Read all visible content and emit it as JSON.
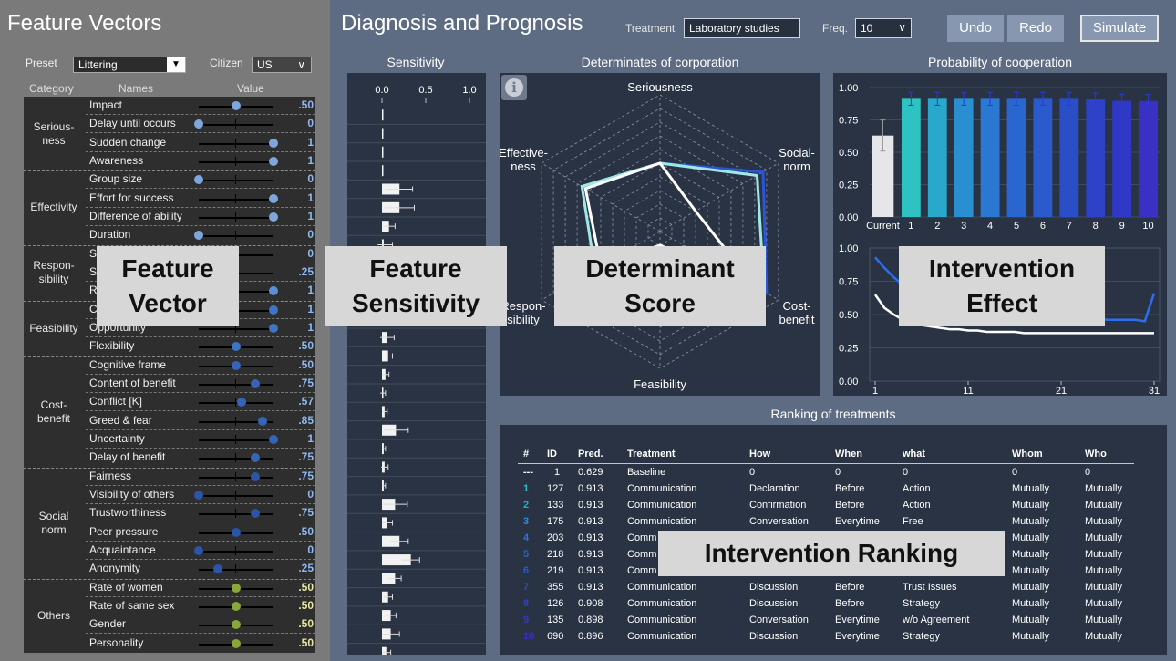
{
  "left": {
    "title": "Feature Vectors",
    "preset_label": "Preset",
    "preset_value": "Littering",
    "citizen_label": "Citizen",
    "citizen_value": "US",
    "headers": [
      "Category",
      "Names",
      "Value"
    ],
    "groups": [
      {
        "name": "Serious-\nness",
        "knob_color": "#7fa6dc",
        "val_color": "#8fb8f0",
        "features": [
          {
            "name": "Impact",
            "value": 0.5,
            "label": ".50"
          },
          {
            "name": "Delay until occurs",
            "value": 0,
            "label": "0"
          },
          {
            "name": "Sudden change",
            "value": 1,
            "label": "1"
          },
          {
            "name": "Awareness",
            "value": 1,
            "label": "1"
          }
        ]
      },
      {
        "name": "Effectivity",
        "knob_color": "#7fa6dc",
        "val_color": "#8fb8f0",
        "features": [
          {
            "name": "Group size",
            "value": 0,
            "label": "0"
          },
          {
            "name": "Effort for success",
            "value": 1,
            "label": "1"
          },
          {
            "name": "Difference of ability",
            "value": 1,
            "label": "1"
          },
          {
            "name": "Duration",
            "value": 0,
            "label": "0"
          }
        ]
      },
      {
        "name": "Respon-\nsibility",
        "knob_color": "#5b8fd6",
        "val_color": "#8fb8f0",
        "features": [
          {
            "name": "S",
            "value": 0,
            "label": "0"
          },
          {
            "name": "S",
            "value": 0.25,
            "label": ".25"
          },
          {
            "name": "R",
            "value": 1,
            "label": "1"
          }
        ]
      },
      {
        "name": "Feasibility",
        "knob_color": "#3f73c4",
        "val_color": "#8fb8f0",
        "features": [
          {
            "name": "C",
            "value": 1,
            "label": "1"
          },
          {
            "name": "Opportunity",
            "value": 1,
            "label": "1"
          },
          {
            "name": "Flexibility",
            "value": 0.5,
            "label": ".50"
          }
        ]
      },
      {
        "name": "Cost-\nbenefit",
        "knob_color": "#3565b8",
        "val_color": "#8fb8f0",
        "features": [
          {
            "name": "Cognitive frame",
            "value": 0.5,
            "label": ".50"
          },
          {
            "name": "Content of benefit",
            "value": 0.75,
            "label": ".75"
          },
          {
            "name": "Conflict [K]",
            "value": 0.57,
            "label": ".57"
          },
          {
            "name": "Greed & fear",
            "value": 0.85,
            "label": ".85"
          },
          {
            "name": "Uncertainty",
            "value": 1,
            "label": "1"
          },
          {
            "name": "Delay of benefit",
            "value": 0.75,
            "label": ".75"
          }
        ]
      },
      {
        "name": "Social\nnorm",
        "knob_color": "#2a55a8",
        "val_color": "#8fb8f0",
        "features": [
          {
            "name": "Fairness",
            "value": 0.75,
            "label": ".75"
          },
          {
            "name": "Visibility of others",
            "value": 0,
            "label": "0"
          },
          {
            "name": "Trustworthiness",
            "value": 0.75,
            "label": ".75"
          },
          {
            "name": "Peer pressure",
            "value": 0.5,
            "label": ".50"
          },
          {
            "name": "Acquaintance",
            "value": 0,
            "label": "0"
          },
          {
            "name": "Anonymity",
            "value": 0.25,
            "label": ".25"
          }
        ]
      },
      {
        "name": "Others",
        "knob_color": "#8aa83a",
        "val_color": "#e8e8a0",
        "features": [
          {
            "name": "Rate of women",
            "value": 0.5,
            "label": ".50"
          },
          {
            "name": "Rate of same sex",
            "value": 0.5,
            "label": ".50"
          },
          {
            "name": "Gender",
            "value": 0.5,
            "label": ".50"
          },
          {
            "name": "Personality",
            "value": 0.5,
            "label": ".50"
          }
        ]
      }
    ]
  },
  "right": {
    "title": "Diagnosis and Prognosis",
    "treatment_label": "Treatment",
    "treatment_value": "Laboratory studies",
    "freq_label": "Freq.",
    "freq_value": "10",
    "undo_label": "Undo",
    "redo_label": "Redo",
    "simulate_label": "Simulate"
  },
  "sensitivity": {
    "title": "Sensitivity",
    "ticks": [
      "0.0",
      "0.5",
      "1.0"
    ],
    "values": [
      0.01,
      0.01,
      0.01,
      0.01,
      0.2,
      0.2,
      0.08,
      0.02,
      0.05,
      0.25,
      0.01,
      0.12,
      0.06,
      0.07,
      0.04,
      0.01,
      0.03,
      0.16,
      0.02,
      0.03,
      0.02,
      0.15,
      0.06,
      0.2,
      0.33,
      0.15,
      0.07,
      0.1,
      0.1,
      0.05,
      0.03
    ],
    "errors": [
      0.0,
      0.0,
      0.0,
      0.0,
      0.15,
      0.17,
      0.07,
      0.1,
      0.06,
      0.1,
      0.0,
      0.1,
      0.08,
      0.05,
      0.04,
      0.03,
      0.03,
      0.14,
      0.02,
      0.04,
      0.02,
      0.14,
      0.06,
      0.1,
      0.1,
      0.07,
      0.05,
      0.06,
      0.1,
      0.05,
      0.04
    ]
  },
  "radar": {
    "title": "Determinates of corporation",
    "axes": [
      "Seriousness",
      "Social-\nnorm",
      "Cost-\nbenefit",
      "Feasibility",
      "Respon-\nsibility",
      "Effective-\nness"
    ],
    "series": [
      {
        "color": "#2b55d6",
        "values": [
          0.5,
          0.87,
          0.9,
          0.1,
          0.5,
          0.63
        ]
      },
      {
        "color": "#9fe8e8",
        "values": [
          0.5,
          0.82,
          0.88,
          0.1,
          0.55,
          0.66
        ]
      },
      {
        "color": "#ffffff",
        "values": [
          0.5,
          0.3,
          0.8,
          0.1,
          0.5,
          0.63
        ]
      }
    ]
  },
  "prob": {
    "title": "Probability of cooperation",
    "yticks": [
      "1.00",
      "0.75",
      "0.50",
      "0.25",
      "0.00"
    ],
    "categories": [
      "Current",
      "1",
      "2",
      "3",
      "4",
      "5",
      "6",
      "7",
      "8",
      "9",
      "10"
    ],
    "values": [
      0.629,
      0.913,
      0.913,
      0.913,
      0.913,
      0.913,
      0.913,
      0.913,
      0.908,
      0.898,
      0.896
    ],
    "errors": [
      0.12,
      0.05,
      0.05,
      0.05,
      0.05,
      0.05,
      0.05,
      0.05,
      0.05,
      0.05,
      0.05
    ],
    "colors": [
      "#e6e6ea",
      "#2ec2c2",
      "#2aa8cc",
      "#2a8fd0",
      "#2a78d2",
      "#2a66d0",
      "#2a5acc",
      "#2a4ec8",
      "#2e42c8",
      "#3038c6",
      "#3a30c4"
    ]
  },
  "effect": {
    "yticks": [
      "1.00",
      "0.75",
      "0.50",
      "0.25",
      "0.00"
    ],
    "xticks": [
      "1",
      "11",
      "21",
      "31"
    ],
    "white": [
      0.65,
      0.55,
      0.5,
      0.46,
      0.44,
      0.42,
      0.41,
      0.4,
      0.39,
      0.39,
      0.38,
      0.38,
      0.37,
      0.37,
      0.37,
      0.37,
      0.36,
      0.36,
      0.36,
      0.36,
      0.36,
      0.36,
      0.36,
      0.36,
      0.36,
      0.36,
      0.36,
      0.36,
      0.36,
      0.36,
      0.36
    ],
    "blue": [
      0.93,
      0.85,
      0.78,
      0.72,
      0.68,
      0.64,
      0.6,
      0.57,
      0.55,
      0.53,
      0.52,
      0.51,
      0.5,
      0.5,
      0.49,
      0.49,
      0.48,
      0.48,
      0.48,
      0.47,
      0.47,
      0.47,
      0.47,
      0.47,
      0.47,
      0.46,
      0.46,
      0.46,
      0.46,
      0.45,
      0.66
    ]
  },
  "ranking": {
    "title": "Ranking of treatments",
    "headers": [
      "#",
      "ID",
      "Pred.",
      "Treatment",
      "How",
      "When",
      "what",
      "Whom",
      "Who"
    ],
    "rows": [
      [
        "---",
        "1",
        "0.629",
        "Baseline",
        "0",
        "0",
        "0",
        "0",
        "0"
      ],
      [
        "1",
        "127",
        "0.913",
        "Communication",
        "Declaration",
        "Before",
        "Action",
        "Mutually",
        "Mutually"
      ],
      [
        "2",
        "133",
        "0.913",
        "Communication",
        "Confirmation",
        "Before",
        "Action",
        "Mutually",
        "Mutually"
      ],
      [
        "3",
        "175",
        "0.913",
        "Communication",
        "Conversation",
        "Everytime",
        "Free",
        "Mutually",
        "Mutually"
      ],
      [
        "4",
        "203",
        "0.913",
        "Comm",
        "",
        "",
        "",
        "Mutually",
        "Mutually"
      ],
      [
        "5",
        "218",
        "0.913",
        "Comm",
        "",
        "",
        "",
        "Mutually",
        "Mutually"
      ],
      [
        "6",
        "219",
        "0.913",
        "Comm",
        "",
        "",
        "",
        "Mutually",
        "Mutually"
      ],
      [
        "7",
        "355",
        "0.913",
        "Communication",
        "Discussion",
        "Before",
        "Trust Issues",
        "Mutually",
        "Mutually"
      ],
      [
        "8",
        "126",
        "0.908",
        "Communication",
        "Discussion",
        "Before",
        "Strategy",
        "Mutually",
        "Mutually"
      ],
      [
        "9",
        "135",
        "0.898",
        "Communication",
        "Conversation",
        "Everytime",
        "w/o Agreement",
        "Mutually",
        "Mutually"
      ],
      [
        "10",
        "690",
        "0.896",
        "Communication",
        "Discussion",
        "Everytime",
        "Strategy",
        "Mutually",
        "Mutually"
      ]
    ],
    "rank_colors": [
      "#ffffff",
      "#2ec2c2",
      "#2aa8cc",
      "#2a8fd0",
      "#2a78d2",
      "#2a66d0",
      "#2a5acc",
      "#2a4ec8",
      "#2e42c8",
      "#3038c6",
      "#3a30c4"
    ]
  },
  "overlays": {
    "feature_vector": "Feature\nVector",
    "feature_sensitivity": "Feature\nSensitivity",
    "determinant_score": "Determinant\nScore",
    "intervention_effect": "Intervention\nEffect",
    "intervention_ranking": "Intervention Ranking"
  }
}
